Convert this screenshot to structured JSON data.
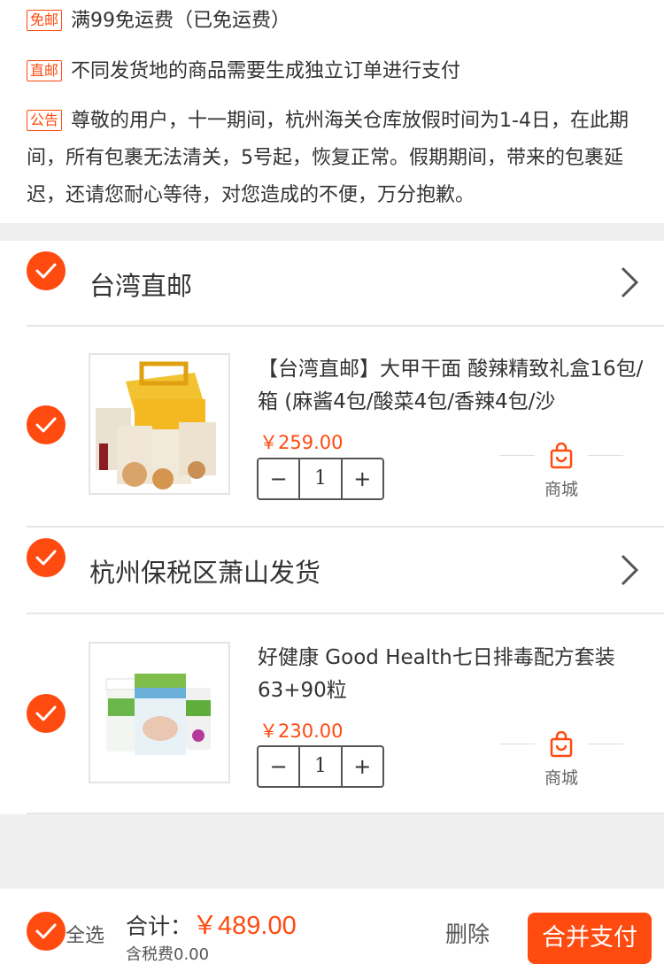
{
  "notices": [
    {
      "tag": "免邮",
      "text": "满99免运费（已免运费）"
    },
    {
      "tag": "直邮",
      "text": "不同发货地的商品需要生成独立订单进行支付"
    },
    {
      "tag": "公告",
      "text": "尊敬的用户，十一期间，杭州海关仓库放假时间为1-4日，在此期间，所有包裹无法清关，5号起，恢复正常。假期期间，带来的包裹延迟，还请您耐心等待，对您造成的不便，万分抱歉。"
    }
  ],
  "groups": [
    {
      "name": "台湾直邮",
      "item": {
        "title": "【台湾直邮】大甲干面 酸辣精致礼盒16包/箱 (麻酱4包/酸菜4包/香辣4包/沙",
        "price": "￥259.00",
        "quantity": "1",
        "store_label": "商城"
      }
    },
    {
      "name": "杭州保税区萧山发货",
      "item": {
        "title": "好健康 Good Health七日排毒配方套装63+90粒",
        "price": "￥230.00",
        "quantity": "1",
        "store_label": "商城"
      }
    }
  ],
  "footer": {
    "select_all": "全选",
    "total_label": "合计：",
    "total_amount": "￥489.00",
    "tax_note": "含税费0.00",
    "delete_label": "删除",
    "pay_label": "合并支付"
  },
  "colors": {
    "accent": "#ff4a10",
    "background": "#efefef"
  },
  "icons": {
    "check": "check-circle-icon",
    "chevron": "chevron-right-icon",
    "minus": "minus-icon",
    "plus": "plus-icon",
    "mall": "shopping-bag-icon"
  }
}
